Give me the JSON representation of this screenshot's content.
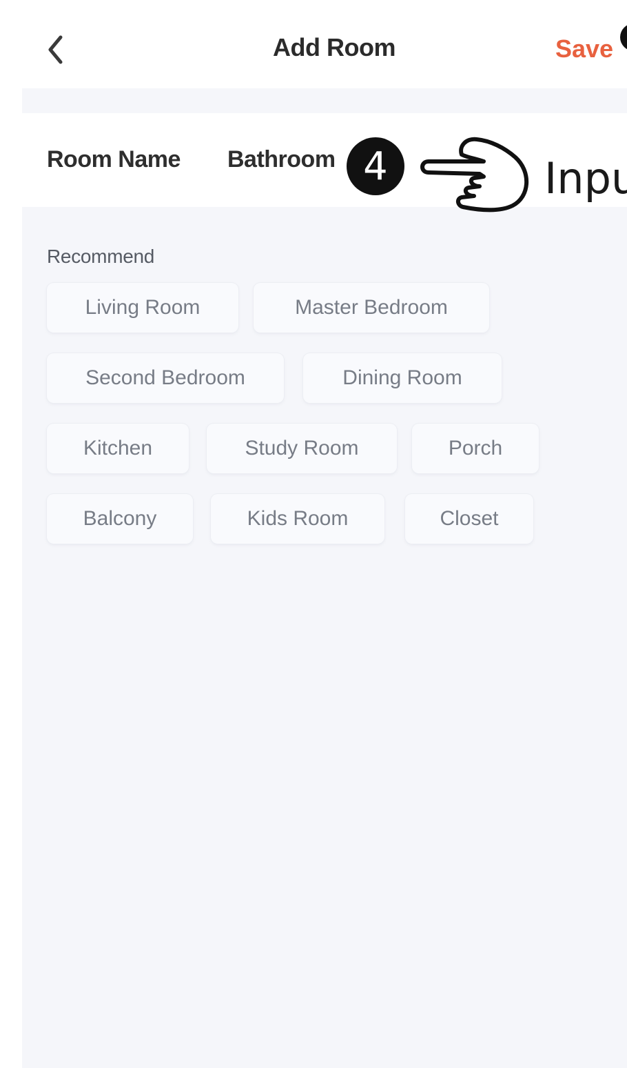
{
  "header": {
    "title": "Add Room",
    "save_label": "Save"
  },
  "room_name": {
    "label": "Room Name",
    "value": "Bathroom"
  },
  "annotation": {
    "step_number": "4",
    "callout_text": "Inpu"
  },
  "recommend": {
    "title": "Recommend",
    "chips": [
      "Living Room",
      "Master Bedroom",
      "Second Bedroom",
      "Dining Room",
      "Kitchen",
      "Study Room",
      "Porch",
      "Balcony",
      "Kids Room",
      "Closet"
    ]
  },
  "colors": {
    "accent": "#e8613f",
    "background": "#f5f6fa"
  },
  "icons": {
    "back": "chevron-left-icon",
    "pointer": "pointing-hand-icon"
  }
}
